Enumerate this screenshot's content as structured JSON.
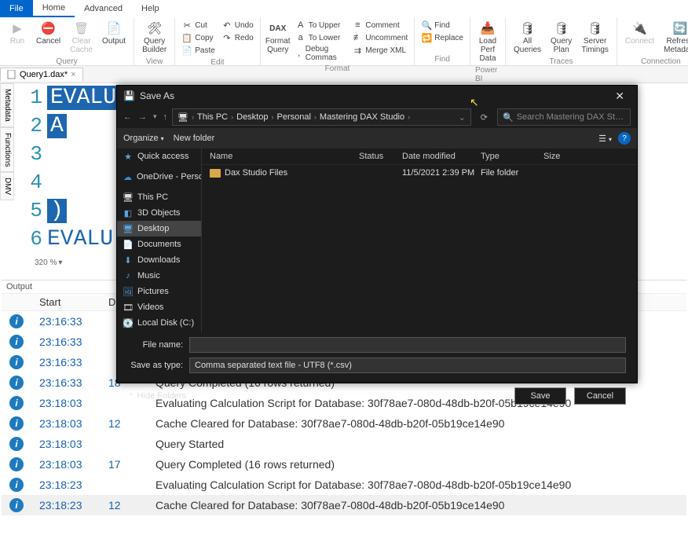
{
  "menu": {
    "file": "File",
    "home": "Home",
    "advanced": "Advanced",
    "help": "Help"
  },
  "ribbon": {
    "run": "Run",
    "cancel": "Cancel",
    "clear_cache": "Clear\nCache",
    "output": "Output",
    "query_builder": "Query\nBuilder",
    "cut": "Cut",
    "copy": "Copy",
    "paste": "Paste",
    "undo": "Undo",
    "redo": "Redo",
    "format_query": "Format\nQuery",
    "to_upper": "To Upper",
    "to_lower": "To Lower",
    "debug_commas": "Debug Commas",
    "comment": "Comment",
    "uncomment": "Uncomment",
    "merge_xml": "Merge XML",
    "find": "Find",
    "replace": "Replace",
    "load_perf": "Load Perf\nData",
    "all_queries": "All\nQueries",
    "query_plan": "Query\nPlan",
    "server_timings": "Server\nTimings",
    "connect": "Connect",
    "refresh_meta": "Refresh\nMetadata",
    "g_query": "Query",
    "g_view": "View",
    "g_edit": "Edit",
    "g_format": "Format",
    "g_find": "Find",
    "g_powerbi": "Power BI",
    "g_traces": "Traces",
    "g_connection": "Connection"
  },
  "doctab": {
    "name": "Query1.dax*"
  },
  "sidebar": {
    "metadata": "Metadata",
    "functions": "Functions",
    "dmv": "DMV"
  },
  "editor": {
    "lines": [
      {
        "n": "1",
        "t": "EVALU",
        "sel": true
      },
      {
        "n": "2",
        "t": "    A",
        "sel": true
      },
      {
        "n": "3",
        "t": "",
        "sel": true
      },
      {
        "n": "4",
        "t": "",
        "sel": true
      },
      {
        "n": "5",
        "t": "    )",
        "sel": true
      },
      {
        "n": "6",
        "t": "EVALU",
        "sel": false
      }
    ],
    "zoom": "320 %"
  },
  "output": {
    "title": "Output",
    "cols": {
      "start": "Start",
      "duration": "D"
    },
    "rows": [
      {
        "t": "23:16:33",
        "d": "",
        "m": ""
      },
      {
        "t": "23:16:33",
        "d": "",
        "m": ""
      },
      {
        "t": "23:16:33",
        "d": "",
        "m": ""
      },
      {
        "t": "23:16:33",
        "d": "18",
        "m": "Query Completed (16 rows returned)"
      },
      {
        "t": "23:18:03",
        "d": "",
        "m": "Evaluating Calculation Script for Database: 30f78ae7-080d-48db-b20f-05b19ce14e90"
      },
      {
        "t": "23:18:03",
        "d": "12",
        "m": "Cache Cleared for Database: 30f78ae7-080d-48db-b20f-05b19ce14e90"
      },
      {
        "t": "23:18:03",
        "d": "",
        "m": "Query Started"
      },
      {
        "t": "23:18:03",
        "d": "17",
        "m": "Query Completed (16 rows returned)"
      },
      {
        "t": "23:18:23",
        "d": "",
        "m": "Evaluating Calculation Script for Database: 30f78ae7-080d-48db-b20f-05b19ce14e90"
      },
      {
        "t": "23:18:23",
        "d": "12",
        "m": "Cache Cleared for Database: 30f78ae7-080d-48db-b20f-05b19ce14e90",
        "hil": true
      }
    ]
  },
  "save": {
    "title": "Save As",
    "breadcrumb": [
      "This PC",
      "Desktop",
      "Personal",
      "Mastering DAX Studio"
    ],
    "search_ph": "Search Mastering DAX Studio",
    "organize": "Organize",
    "newfolder": "New folder",
    "tree": {
      "quick": "Quick access",
      "onedrive": "OneDrive - Person",
      "thispc": "This PC",
      "objects": "3D Objects",
      "desktop": "Desktop",
      "documents": "Documents",
      "downloads": "Downloads",
      "music": "Music",
      "pictures": "Pictures",
      "videos": "Videos",
      "localdisk": "Local Disk (C:)"
    },
    "cols": {
      "name": "Name",
      "status": "Status",
      "date": "Date modified",
      "type": "Type",
      "size": "Size"
    },
    "files": [
      {
        "name": "Dax Studio Files",
        "date": "11/5/2021 2:39 PM",
        "type": "File folder"
      }
    ],
    "filename_lbl": "File name:",
    "type_lbl": "Save as type:",
    "filename": "",
    "filetype": "Comma separated text file - UTF8 (*.csv)",
    "hide": "Hide Folders",
    "save": "Save",
    "cancel": "Cancel"
  }
}
